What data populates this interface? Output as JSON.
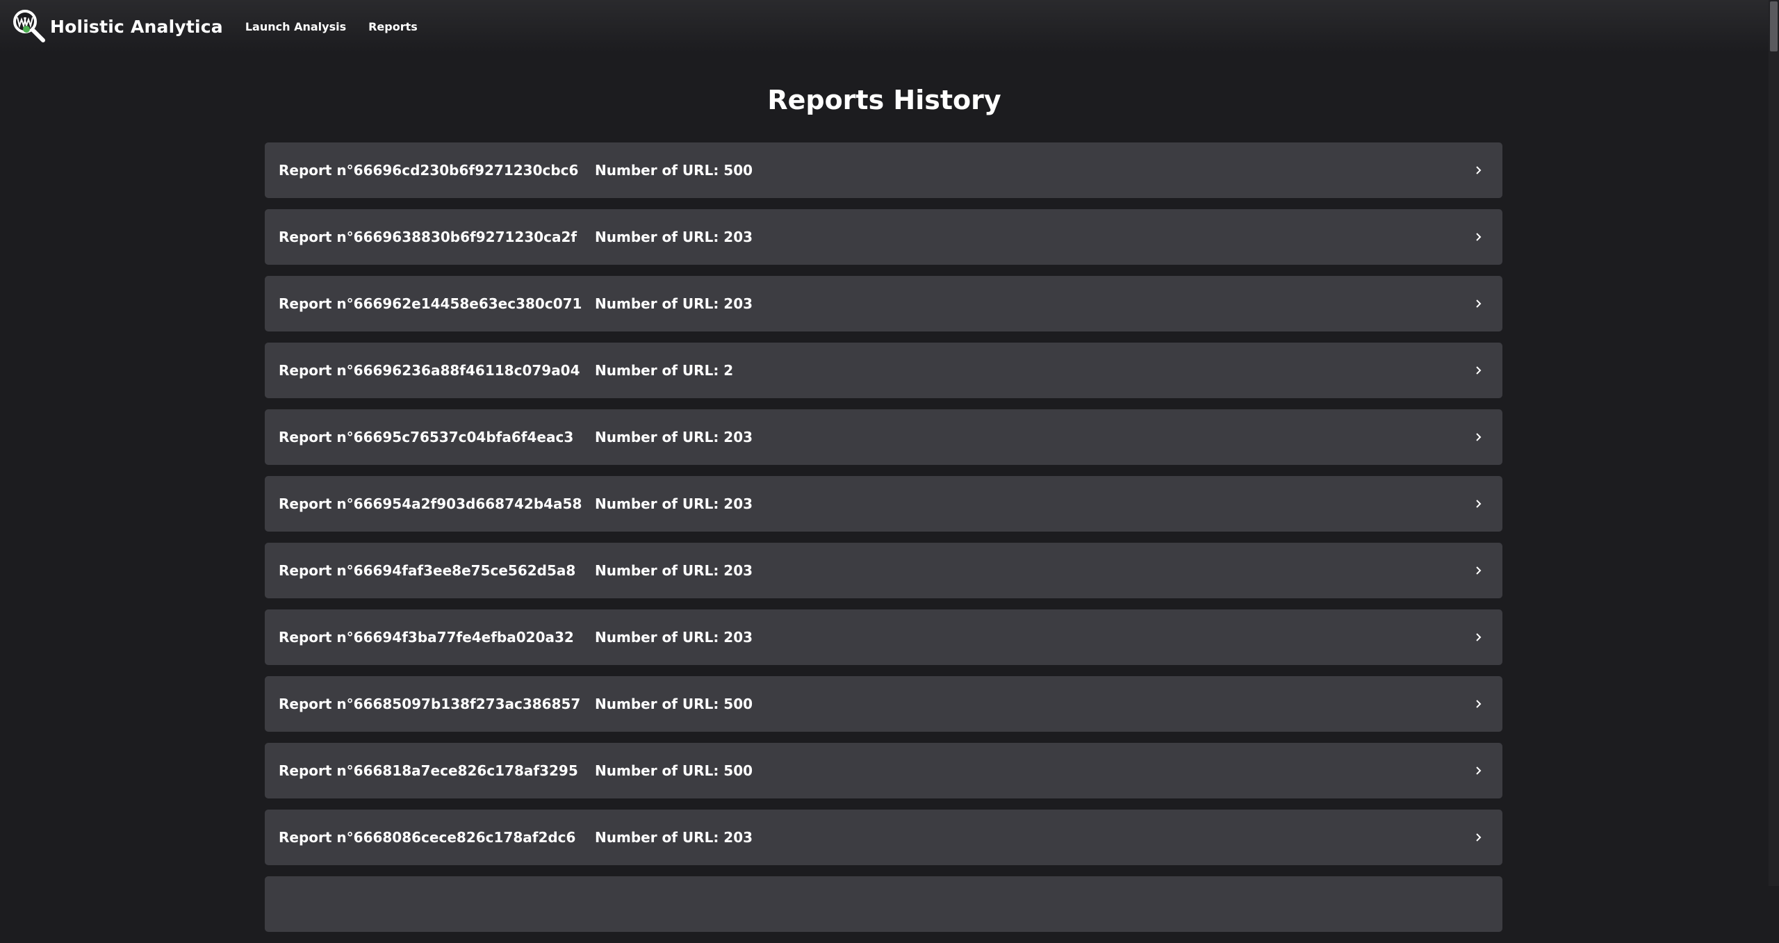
{
  "nav": {
    "brand": "Holistic Analytica",
    "links": [
      "Launch Analysis",
      "Reports"
    ]
  },
  "page": {
    "title": "Reports History"
  },
  "reports": [
    {
      "id": "Report n°66696cd230b6f9271230cbc6",
      "urls": "Number of URL: 500"
    },
    {
      "id": "Report n°6669638830b6f9271230ca2f",
      "urls": "Number of URL: 203"
    },
    {
      "id": "Report n°666962e14458e63ec380c071",
      "urls": "Number of URL: 203"
    },
    {
      "id": "Report n°66696236a88f46118c079a04",
      "urls": "Number of URL: 2"
    },
    {
      "id": "Report n°66695c76537c04bfa6f4eac3",
      "urls": "Number of URL: 203"
    },
    {
      "id": "Report n°666954a2f903d668742b4a58",
      "urls": "Number of URL: 203"
    },
    {
      "id": "Report n°66694faf3ee8e75ce562d5a8",
      "urls": "Number of URL: 203"
    },
    {
      "id": "Report n°66694f3ba77fe4efba020a32",
      "urls": "Number of URL: 203"
    },
    {
      "id": "Report n°66685097b138f273ac386857",
      "urls": "Number of URL: 500"
    },
    {
      "id": "Report n°666818a7ece826c178af3295",
      "urls": "Number of URL: 500"
    },
    {
      "id": "Report n°6668086cece826c178af2dc6",
      "urls": "Number of URL: 203"
    }
  ],
  "colors": {
    "background": "#1c1c1f",
    "row": "#3d3d42",
    "logo_accent": "#4caf50"
  },
  "icons": {
    "logo": "www-magnifier-logo",
    "row_action": "chevron-right-icon"
  }
}
